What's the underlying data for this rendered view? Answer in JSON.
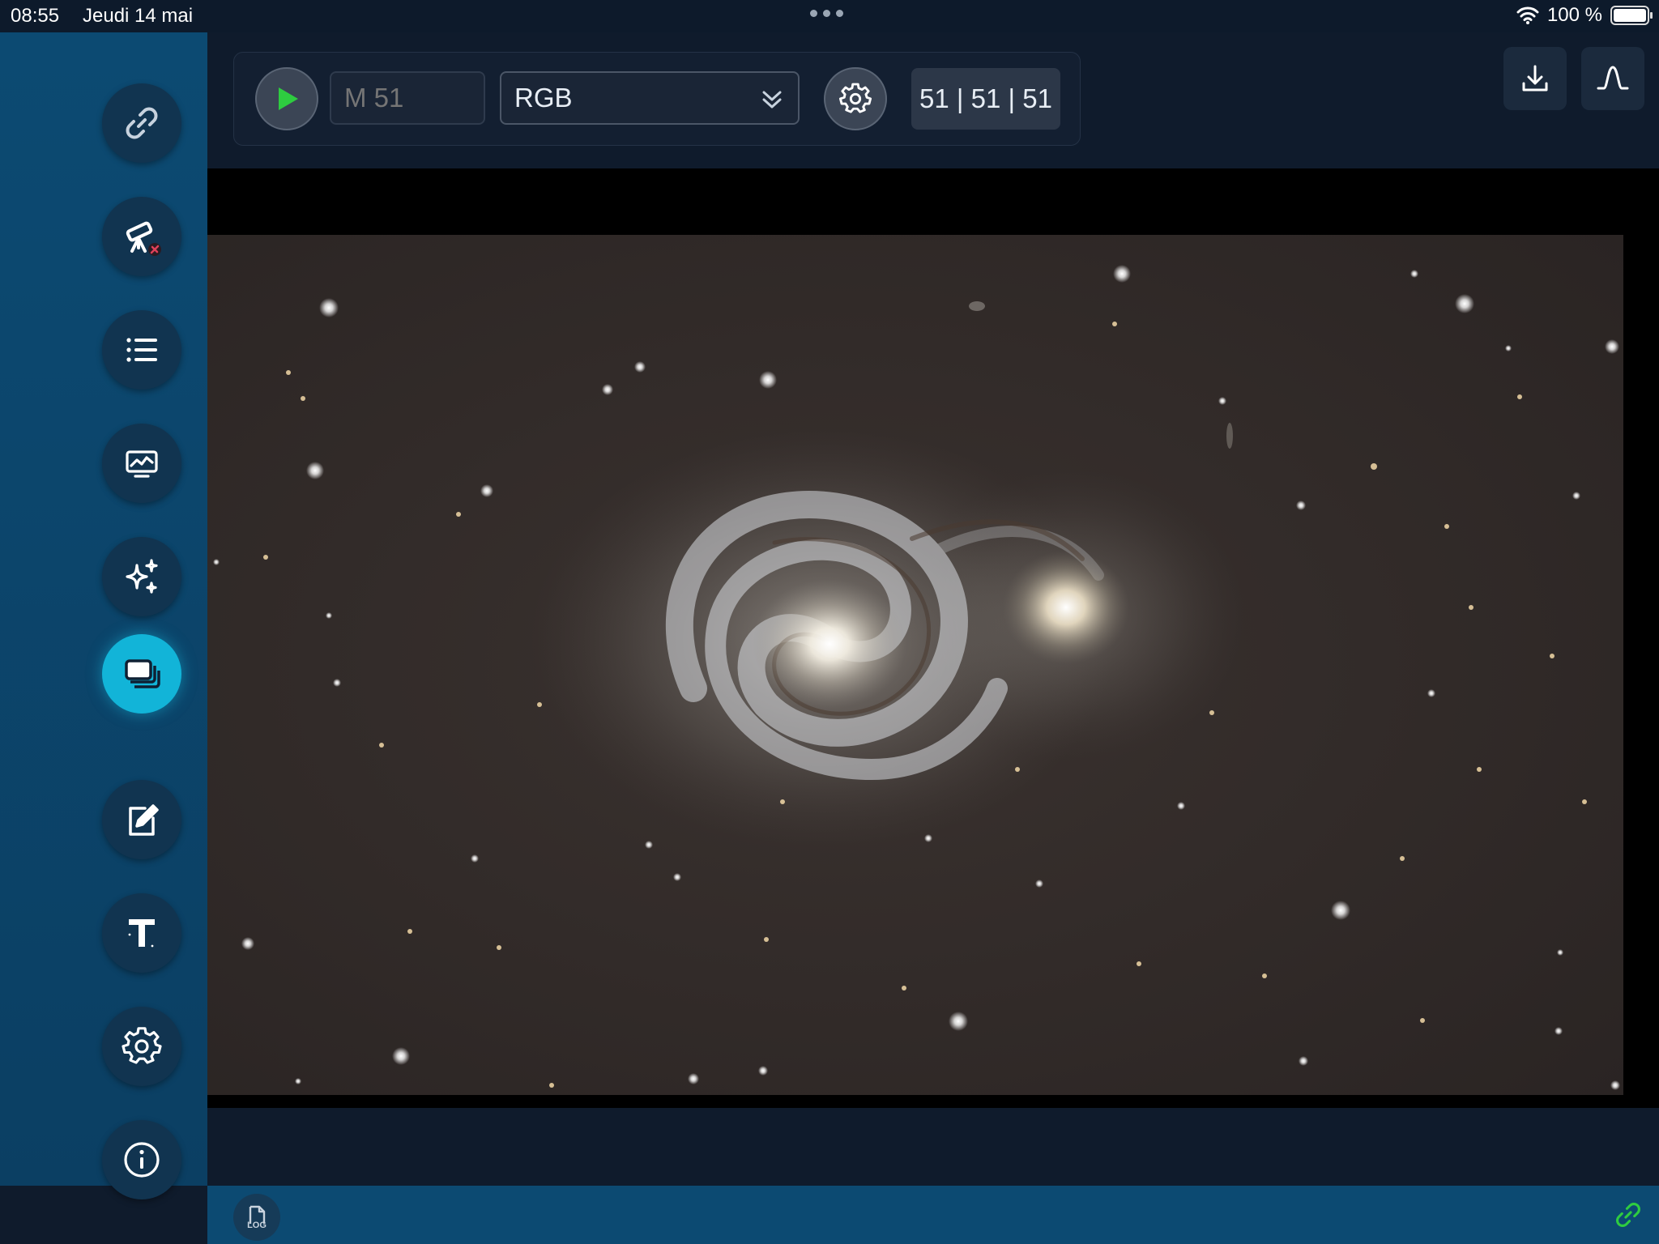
{
  "status": {
    "time": "08:55",
    "date": "Jeudi 14 mai",
    "battery": "100 %"
  },
  "sidebar": {
    "items": [
      {
        "name": "connection",
        "icon": "link-icon"
      },
      {
        "name": "telescope",
        "icon": "telescope-icon"
      },
      {
        "name": "list",
        "icon": "list-icon"
      },
      {
        "name": "monitor",
        "icon": "monitor-chart-icon"
      },
      {
        "name": "enhance",
        "icon": "sparkles-icon"
      },
      {
        "name": "stack",
        "icon": "stack-icon",
        "active": true
      },
      {
        "name": "edit",
        "icon": "edit-icon"
      },
      {
        "name": "text",
        "icon": "text-icon"
      },
      {
        "name": "settings",
        "icon": "gear-icon"
      },
      {
        "name": "info",
        "icon": "info-icon"
      }
    ]
  },
  "toolbar": {
    "target_placeholder": "M 51",
    "filter_value": "RGB",
    "stats": "51 | 51 | 51"
  },
  "bottom": {
    "log_label": "LOG"
  },
  "colors": {
    "accent": "#12b4d8",
    "play_green": "#2ecc40",
    "sidebar_bg": "#0c4a72"
  }
}
